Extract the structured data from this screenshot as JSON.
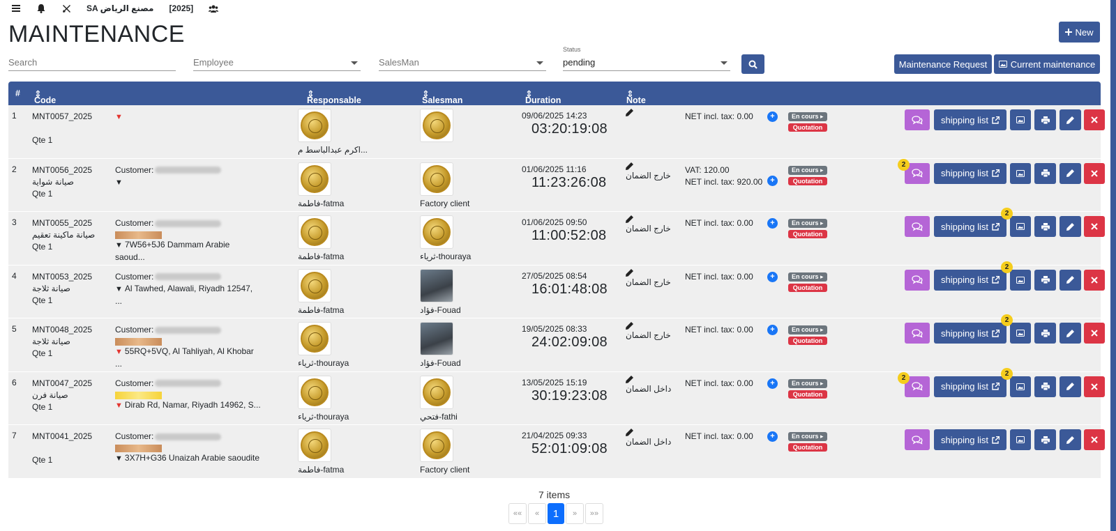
{
  "topbar": {
    "company": "SA مصنع الرياض",
    "year": "[2025]"
  },
  "page_title": "MAINTENANCE",
  "buttons": {
    "new": "New",
    "maintenance_request": "Maintenance Request",
    "current_maintenance": "Current maintenance"
  },
  "filters": {
    "search_placeholder": "Search",
    "employee_placeholder": "Employee",
    "salesman_placeholder": "SalesMan",
    "status_label": "Status",
    "status_value": "pending"
  },
  "table": {
    "headers": {
      "num": "#",
      "code": "Code",
      "responsable": "Responsable",
      "salesman": "Salesman",
      "duration": "Duration",
      "note": "Note"
    },
    "rows": [
      {
        "num": "1",
        "code": "MNT0057_2025",
        "type": "",
        "qty": "Qte 1",
        "customer": "",
        "address": "",
        "responsable": "اكرم عبدالباسط م...",
        "salesman": "",
        "date": "09/06/2025 14:23",
        "timer": "03:20:19:08",
        "note": "",
        "vat": "",
        "net": "NET incl. tax: 0.00",
        "status_badge": "En cours",
        "quote_badge": "Quotation",
        "shipping": "shipping list",
        "chat_count": "",
        "ship_count": ""
      },
      {
        "num": "2",
        "code": "MNT0056_2025",
        "type": "صيانة شواية",
        "qty": "Qte 1",
        "customer": "Customer:",
        "address": "",
        "responsable": "فاطمة-fatma",
        "salesman": "Factory client",
        "date": "01/06/2025 11:16",
        "timer": "11:23:26:08",
        "note": "خارج الضمان",
        "vat": "VAT: 120.00",
        "net": "NET incl. tax: 920.00",
        "status_badge": "En cours",
        "quote_badge": "Quotation",
        "shipping": "shipping list",
        "chat_count": "2",
        "ship_count": ""
      },
      {
        "num": "3",
        "code": "MNT0055_2025",
        "type": "صيانة ماكينة تعقيم",
        "qty": "Qte 1",
        "customer": "Customer:",
        "address": "7W56+5J6 Dammam Arabie saoud...",
        "responsable": "فاطمة-fatma",
        "salesman": "ثرياء-thouraya",
        "date": "01/06/2025 09:50",
        "timer": "11:00:52:08",
        "note": "خارج الضمان",
        "vat": "",
        "net": "NET incl. tax: 0.00",
        "status_badge": "En cours",
        "quote_badge": "Quotation",
        "shipping": "shipping list",
        "chat_count": "",
        "ship_count": "2"
      },
      {
        "num": "4",
        "code": "MNT0053_2025",
        "type": "صيانة ثلاجة",
        "qty": "Qte 1",
        "customer": "Customer:",
        "address": "Al Tawhed, Alawali, Riyadh 12547, ...",
        "responsable": "فاطمة-fatma",
        "salesman": "فؤاد-Fouad",
        "date": "27/05/2025 08:54",
        "timer": "16:01:48:08",
        "note": "خارج الضمان",
        "vat": "",
        "net": "NET incl. tax: 0.00",
        "status_badge": "En cours",
        "quote_badge": "Quotation",
        "shipping": "shipping list",
        "chat_count": "",
        "ship_count": "2"
      },
      {
        "num": "5",
        "code": "MNT0048_2025",
        "type": "صيانة ثلاجة",
        "qty": "Qte 1",
        "customer": "Customer:",
        "address": "55RQ+5VQ, Al Tahliyah, Al Khobar ...",
        "responsable": "ثرياء-thouraya",
        "salesman": "فؤاد-Fouad",
        "date": "19/05/2025 08:33",
        "timer": "24:02:09:08",
        "note": "خارج الضمان",
        "vat": "",
        "net": "NET incl. tax: 0.00",
        "status_badge": "En cours",
        "quote_badge": "Quotation",
        "shipping": "shipping list",
        "chat_count": "",
        "ship_count": "2"
      },
      {
        "num": "6",
        "code": "MNT0047_2025",
        "type": "صيانة فرن",
        "qty": "Qte 1",
        "customer": "Customer:",
        "address": "Dirab Rd, Namar, Riyadh 14962, S...",
        "responsable": "ثرياء-thouraya",
        "salesman": "فتحي-fathi",
        "date": "13/05/2025 15:19",
        "timer": "30:19:23:08",
        "note": "داخل الضمان",
        "vat": "",
        "net": "NET incl. tax: 0.00",
        "status_badge": "En cours",
        "quote_badge": "Quotation",
        "shipping": "shipping list",
        "chat_count": "2",
        "ship_count": "2"
      },
      {
        "num": "7",
        "code": "MNT0041_2025",
        "type": "",
        "qty": "Qte 1",
        "customer": "Customer:",
        "address": "3X7H+G36 Unaizah Arabie saoudite",
        "responsable": "فاطمة-fatma",
        "salesman": "Factory client",
        "date": "21/04/2025 09:33",
        "timer": "52:01:09:08",
        "note": "داخل الضمان",
        "vat": "",
        "net": "NET incl. tax: 0.00",
        "status_badge": "En cours",
        "quote_badge": "Quotation",
        "shipping": "shipping list",
        "chat_count": "",
        "ship_count": ""
      }
    ]
  },
  "footer": {
    "items_count": "7 items",
    "pager": {
      "first": "««",
      "prev": "«",
      "current": "1",
      "next": "»",
      "last": "»»"
    }
  },
  "colors": {
    "primary": "#3b5998",
    "danger": "#dc3545",
    "chat": "#b565d6",
    "badge": "#f5cd1d",
    "row_bg": "#efefef"
  }
}
